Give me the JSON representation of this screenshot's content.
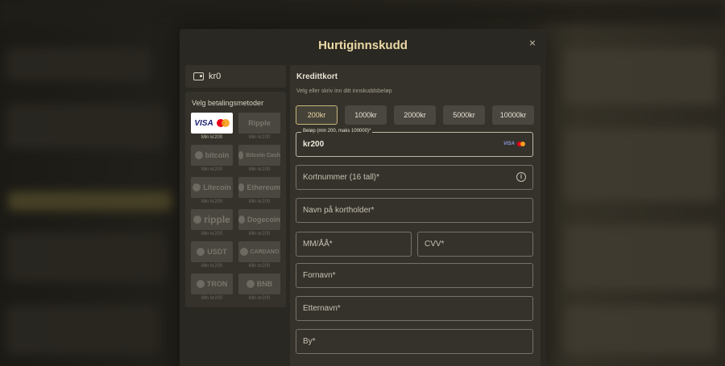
{
  "modal": {
    "title": "Hurtiginnskudd",
    "close": "×"
  },
  "wallet": {
    "balance": "kr0"
  },
  "methods": {
    "title": "Velg betalingsmetoder",
    "items": [
      {
        "name": "VISA",
        "label": "Min kr200",
        "active": true
      },
      {
        "name": "Ripple",
        "label": "Min kr200"
      },
      {
        "name": "bitcoin",
        "label": "Min kr200"
      },
      {
        "name": "Bitcoin Cash",
        "label": "Min kr200"
      },
      {
        "name": "Litecoin",
        "label": "Min kr200"
      },
      {
        "name": "Ethereum",
        "label": "Min kr200"
      },
      {
        "name": "ripple",
        "label": "Min kr200"
      },
      {
        "name": "Dogecoin",
        "label": "Min kr200"
      },
      {
        "name": "USDT",
        "label": "Min kr200"
      },
      {
        "name": "CARDANO",
        "label": "Min kr200"
      },
      {
        "name": "TRON",
        "label": "Min kr200"
      },
      {
        "name": "BNB",
        "label": "Min kr200"
      }
    ]
  },
  "form": {
    "title": "Kredittkort",
    "subtitle": "Velg eller skriv inn ditt innskuddsbeløp",
    "amounts": [
      "200kr",
      "1000kr",
      "2000kr",
      "5000kr",
      "10000kr"
    ],
    "amount_field": {
      "legend": "Beløp (min 200, maks 100000)*",
      "value": "kr200",
      "visa": "VISA"
    },
    "card_number": "Kortnummer (16 tall)*",
    "card_holder": "Navn på kortholder*",
    "expiry": "MM/ÅÅ*",
    "cvv": "CVV*",
    "first_name": "Fornavn*",
    "last_name": "Etternavn*",
    "city": "By*"
  },
  "colors": {
    "accent": "#ecd9a6",
    "modal_bg": "#2a2822",
    "panel_bg": "#35322b"
  }
}
